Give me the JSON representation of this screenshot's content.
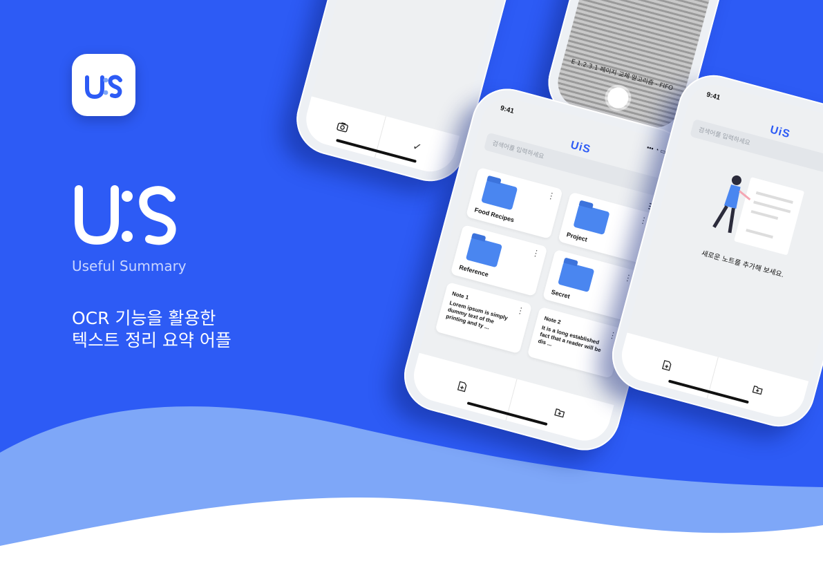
{
  "brand": {
    "icon_text": "UiS",
    "logo_text": "UiS",
    "subtitle": "Useful Summary",
    "tagline_line1": "OCR 기능을 활용한",
    "tagline_line2": "텍스트 정리 요약 어플",
    "colors": {
      "background": "#2d5bf5",
      "wave_light": "#7ea7f8",
      "wave_white": "#ffffff",
      "accent": "#2d5bf5"
    }
  },
  "phone_camera": {
    "bottom_left_icon": "camera-icon",
    "bottom_right_icon": "check-icon",
    "bottom_right_label": "✓"
  },
  "phone_scan": {
    "text": "E 1.2.3.1 페이지 교체 알고리즘 - FIFO"
  },
  "phone_main": {
    "time": "9:41",
    "app_logo": "UiS",
    "search_placeholder": "검색어를 입력하세요",
    "folders": [
      {
        "name": "Food Recipes"
      },
      {
        "name": "Project"
      },
      {
        "name": "Reference"
      },
      {
        "name": "Secret"
      }
    ],
    "notes": [
      {
        "title": "Note 1",
        "preview": "Lorem ipsum is simply dummy text of the printing and ty ..."
      },
      {
        "title": "Note 2",
        "preview": "It is a long established fact that a reader will be dis ..."
      }
    ],
    "bottom_icons": [
      "new-note-icon",
      "new-folder-icon"
    ]
  },
  "phone_empty": {
    "time": "9:41",
    "app_logo": "UiS",
    "search_placeholder": "검색어를 입력하세요",
    "empty_message": "새로운 노트를 추가해 보세요.",
    "fab_label": "+"
  }
}
